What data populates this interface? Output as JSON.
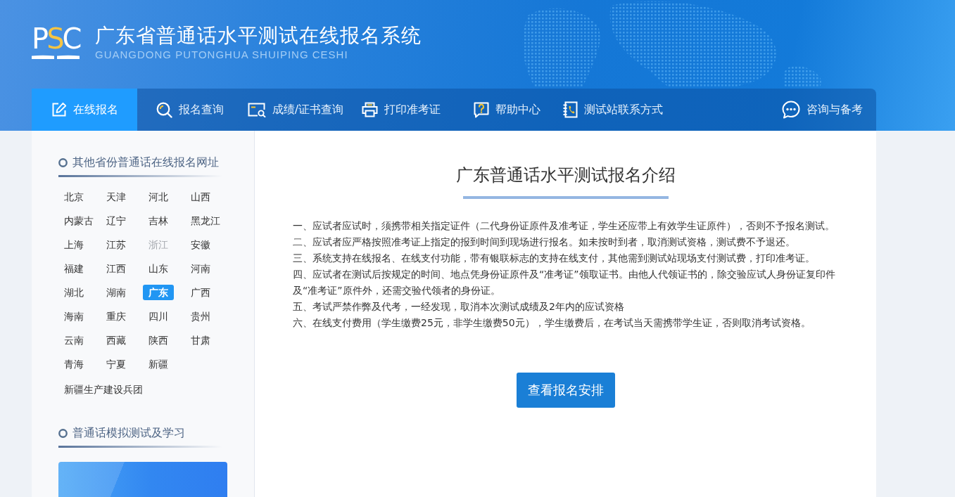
{
  "header": {
    "logo": {
      "letters": [
        {
          "text": "P",
          "highlight": false
        },
        {
          "text": "S",
          "highlight": true
        },
        {
          "text": "C",
          "highlight": false
        }
      ]
    },
    "title": "广东省普通话水平测试在线报名系统",
    "subtitle": "GUANGDONG PUTONGHUA SHUIPING CESHI"
  },
  "nav": {
    "tabs": [
      {
        "label": "在线报名",
        "selected": true
      },
      {
        "label": "报名查询",
        "selected": false
      },
      {
        "label": "成绩/证书查询",
        "selected": false
      },
      {
        "label": "打印准考证",
        "selected": false
      },
      {
        "label": "帮助中心",
        "selected": false
      },
      {
        "label": "测试站联系方式",
        "selected": false
      }
    ],
    "side_link": {
      "label": "咨询与备考"
    }
  },
  "sidebar": {
    "province_section": {
      "title": "其他省份普通话在线报名网址",
      "provinces": [
        {
          "name": "北京",
          "selected": false,
          "disabled": false
        },
        {
          "name": "天津",
          "selected": false,
          "disabled": false
        },
        {
          "name": "河北",
          "selected": false,
          "disabled": false
        },
        {
          "name": "山西",
          "selected": false,
          "disabled": false
        },
        {
          "name": "内蒙古",
          "selected": false,
          "disabled": false
        },
        {
          "name": "辽宁",
          "selected": false,
          "disabled": false
        },
        {
          "name": "吉林",
          "selected": false,
          "disabled": false
        },
        {
          "name": "黑龙江",
          "selected": false,
          "disabled": false
        },
        {
          "name": "上海",
          "selected": false,
          "disabled": false
        },
        {
          "name": "江苏",
          "selected": false,
          "disabled": false
        },
        {
          "name": "浙江",
          "selected": false,
          "disabled": true
        },
        {
          "name": "安徽",
          "selected": false,
          "disabled": false
        },
        {
          "name": "福建",
          "selected": false,
          "disabled": false
        },
        {
          "name": "江西",
          "selected": false,
          "disabled": false
        },
        {
          "name": "山东",
          "selected": false,
          "disabled": false
        },
        {
          "name": "河南",
          "selected": false,
          "disabled": false
        },
        {
          "name": "湖北",
          "selected": false,
          "disabled": false
        },
        {
          "name": "湖南",
          "selected": false,
          "disabled": false
        },
        {
          "name": "广东",
          "selected": true,
          "disabled": false
        },
        {
          "name": "广西",
          "selected": false,
          "disabled": false
        },
        {
          "name": "海南",
          "selected": false,
          "disabled": false
        },
        {
          "name": "重庆",
          "selected": false,
          "disabled": false
        },
        {
          "name": "四川",
          "selected": false,
          "disabled": false
        },
        {
          "name": "贵州",
          "selected": false,
          "disabled": false
        },
        {
          "name": "云南",
          "selected": false,
          "disabled": false
        },
        {
          "name": "西藏",
          "selected": false,
          "disabled": false
        },
        {
          "name": "陕西",
          "selected": false,
          "disabled": false
        },
        {
          "name": "甘肃",
          "selected": false,
          "disabled": false
        },
        {
          "name": "青海",
          "selected": false,
          "disabled": false
        },
        {
          "name": "宁夏",
          "selected": false,
          "disabled": false
        },
        {
          "name": "新疆",
          "selected": false,
          "disabled": false
        }
      ],
      "extra_link": "新疆生产建设兵团"
    },
    "study_section": {
      "title": "普通话模拟测试及学习"
    }
  },
  "main": {
    "title": "广东普通话水平测试报名介绍",
    "rules": [
      "一、应试者应试时，须携带相关指定证件（二代身份证原件及准考证，学生还应带上有效学生证原件），否则不予报名测试。",
      "二、应试者应严格按照准考证上指定的报到时间到现场进行报名。如未按时到者，取消测试资格，测试费不予退还。",
      "三、系统支持在线报名、在线支付功能，带有银联标志的支持在线支付，其他需到测试站现场支付测试费，打印准考证。",
      "四、应试者在测试后按规定的时间、地点凭身份证原件及“准考证”领取证书。由他人代领证书的，除交验应试人身份证复印件及“准考证”原件外，还需交验代领者的身份证。",
      "五、考试严禁作弊及代考，一经发现，取消本次测试成绩及2年内的应试资格",
      "六、在线支付费用（学生缴费25元，非学生缴费50元），学生缴费后，在考试当天需携带学生证，否则取消考试资格。"
    ],
    "button": "查看报名安排"
  }
}
